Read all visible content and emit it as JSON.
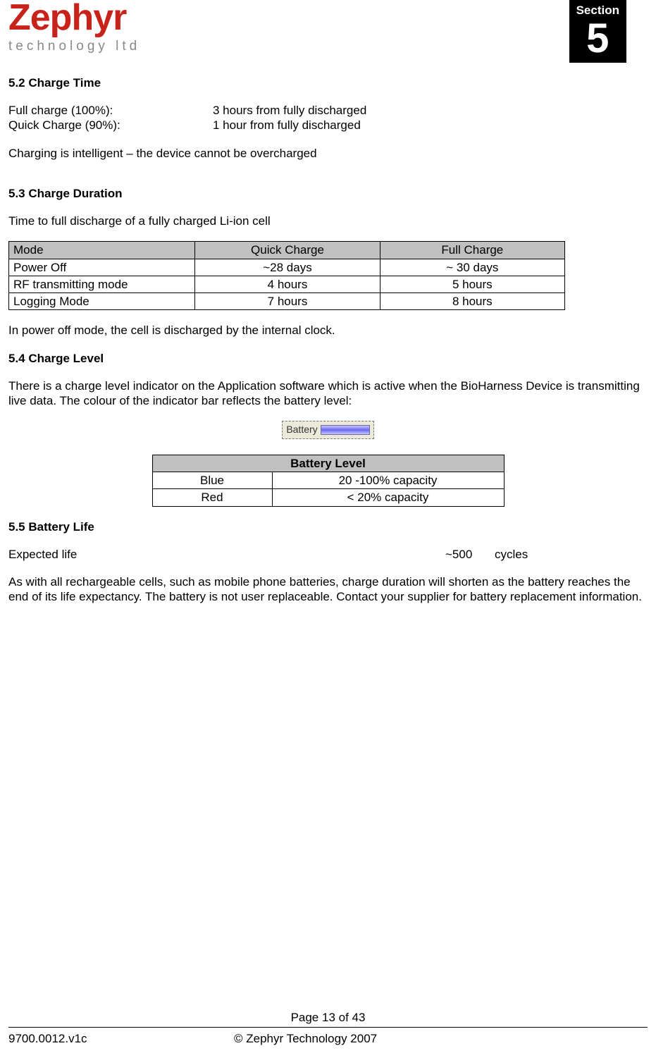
{
  "logo": {
    "main": "Zephyr",
    "sub": "technology ltd"
  },
  "section_tag": {
    "label": "Section",
    "number": "5"
  },
  "s52": {
    "heading": "5.2 Charge Time",
    "rows": [
      {
        "label": "Full charge (100%):",
        "value": "3 hours from fully discharged"
      },
      {
        "label": "Quick Charge (90%):",
        "value": "1 hour from fully discharged"
      }
    ],
    "note": "Charging is intelligent – the device cannot be overcharged"
  },
  "s53": {
    "heading": "5.3 Charge Duration",
    "intro": "Time to full discharge of a fully charged Li-ion cell",
    "headers": [
      "Mode",
      "Quick Charge",
      "Full Charge"
    ],
    "rows": [
      [
        "Power Off",
        "~28 days",
        "~ 30 days"
      ],
      [
        "RF transmitting mode",
        "4 hours",
        "5 hours"
      ],
      [
        "Logging Mode",
        "7 hours",
        "8 hours"
      ]
    ],
    "note": "In power off mode, the cell is discharged by the internal clock."
  },
  "s54": {
    "heading": "5.4 Charge Level",
    "para": "There is a charge level indicator on the Application software which is active when the BioHarness Device is transmitting live data. The colour of the indicator bar reflects the battery level:",
    "widget_label": "Battery",
    "table_header": "Battery Level",
    "rows": [
      [
        "Blue",
        "20 -100% capacity"
      ],
      [
        "Red",
        "< 20% capacity"
      ]
    ]
  },
  "s55": {
    "heading": "5.5 Battery Life",
    "expected_label": "Expected life",
    "expected_value": "~500",
    "expected_unit": "cycles",
    "para": "As with all rechargeable cells, such as mobile phone batteries, charge duration will shorten as the battery reaches the end of its life expectancy. The battery is not user replaceable. Contact your supplier for battery replacement information."
  },
  "footer": {
    "page": "Page 13 of 43",
    "doc": "9700.0012.v1c",
    "copyright": "© Zephyr Technology 2007"
  }
}
